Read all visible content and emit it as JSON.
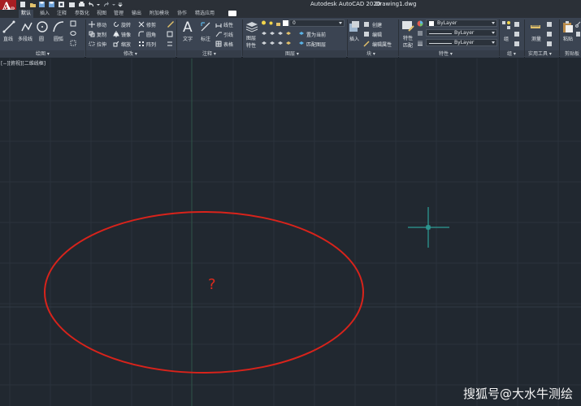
{
  "app": {
    "logo_letter": "A",
    "logo_sub": "CAD",
    "title": "Autodesk AutoCAD 2020",
    "document": "Drawing1.dwg"
  },
  "tabs": [
    {
      "label": "默认",
      "active": true
    },
    {
      "label": "插入"
    },
    {
      "label": "注释"
    },
    {
      "label": "参数化"
    },
    {
      "label": "视图"
    },
    {
      "label": "管理"
    },
    {
      "label": "输出"
    },
    {
      "label": "附加模块"
    },
    {
      "label": "协作"
    },
    {
      "label": "精选应用"
    }
  ],
  "ribbon": {
    "draw": {
      "line": "直线",
      "polyline": "多段线",
      "circle": "圆",
      "arc": "圆弧",
      "title": "绘图 ▾"
    },
    "modify": {
      "move": "移动",
      "rotate": "旋转",
      "trim": "修剪",
      "copy": "复制",
      "mirror": "镜像",
      "fillet": "圆角",
      "stretch": "拉伸",
      "scale": "缩放",
      "array": "阵列",
      "title": "修改 ▾"
    },
    "annotation": {
      "text": "文字",
      "dimension": "标注",
      "linear": "线性",
      "leader": "引线",
      "table": "表格",
      "title": "注释 ▾"
    },
    "layers": {
      "properties_line1": "图层",
      "properties_line2": "特性",
      "current_layer": "0",
      "make_current": "置为当前",
      "match_layer": "匹配图层",
      "title": "图层 ▾"
    },
    "block": {
      "insert": "插入",
      "create": "创建",
      "edit": "编辑",
      "edit_attributes": "编辑属性",
      "title": "块 ▾"
    },
    "properties": {
      "match_line1": "特性",
      "match_line2": "匹配",
      "color": "ByLayer",
      "linetype": "ByLayer",
      "lineweight": "ByLayer",
      "title": "特性 ▾"
    },
    "groups": {
      "group": "组",
      "title": "组 ▾"
    },
    "utilities": {
      "measure": "测量",
      "title": "实用工具 ▾"
    },
    "clipboard": {
      "paste": "粘贴",
      "title": "剪贴板"
    }
  },
  "viewport": {
    "label": "[−][俯视][二维线框]"
  },
  "drawing": {
    "question_mark": "?",
    "ellipse_color": "#d8231b",
    "crosshair_color": "#2fb8ae"
  },
  "watermark": "搜狐号@大水牛测绘"
}
